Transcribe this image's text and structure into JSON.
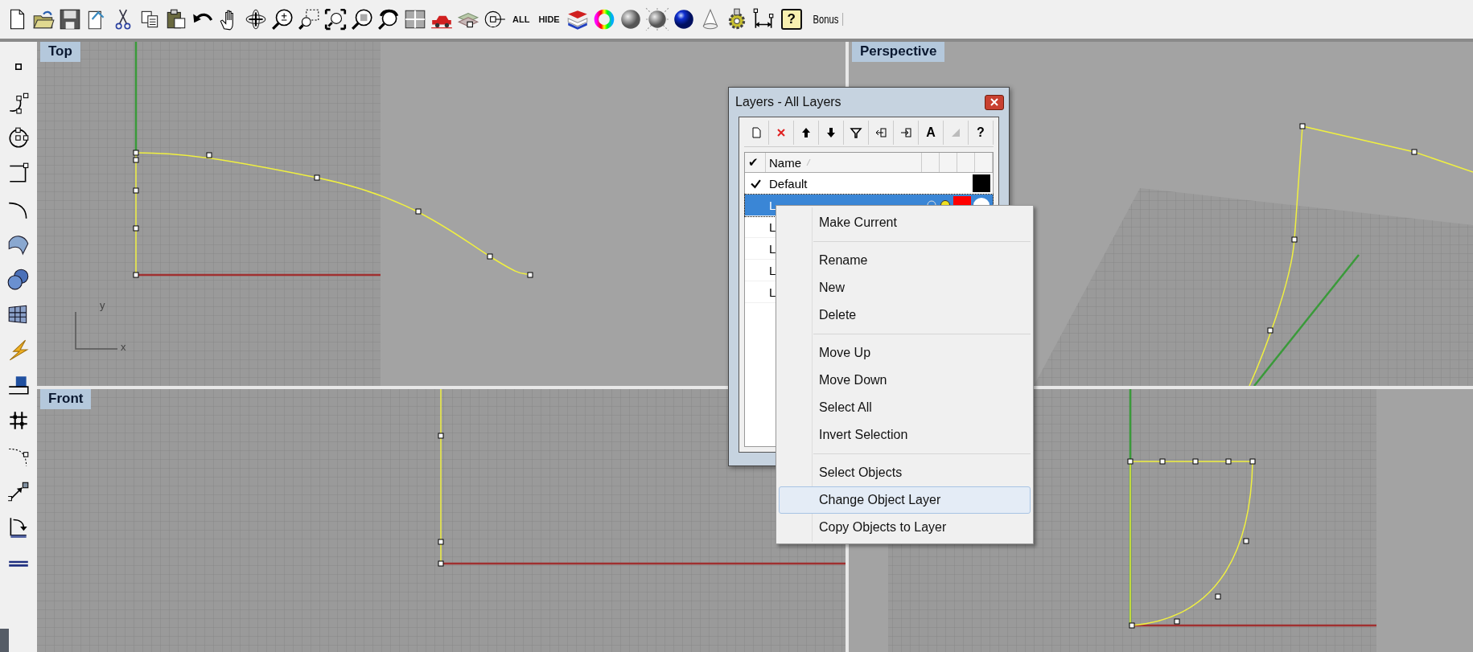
{
  "toolbar": {
    "items": [
      {
        "kind": "new"
      },
      {
        "kind": "open"
      },
      {
        "kind": "save"
      },
      {
        "kind": "props"
      },
      {
        "kind": "cut"
      },
      {
        "kind": "copy"
      },
      {
        "kind": "paste"
      },
      {
        "kind": "undo"
      },
      {
        "kind": "pan"
      },
      {
        "kind": "rotate"
      },
      {
        "kind": "zoom"
      },
      {
        "kind": "zoomwin"
      },
      {
        "kind": "zoomext"
      },
      {
        "kind": "zoomsel"
      },
      {
        "kind": "undoview"
      },
      {
        "kind": "fourview"
      },
      {
        "kind": "car"
      },
      {
        "kind": "gridlayers"
      },
      {
        "kind": "point"
      },
      {
        "kind": "text",
        "label": "ALL"
      },
      {
        "kind": "text",
        "label": "HIDE"
      },
      {
        "kind": "stack"
      },
      {
        "kind": "wheel"
      },
      {
        "kind": "sphere"
      },
      {
        "kind": "wiresphere"
      },
      {
        "kind": "bluesphere"
      },
      {
        "kind": "cone"
      },
      {
        "kind": "gear"
      },
      {
        "kind": "dim"
      },
      {
        "kind": "help",
        "label": "?"
      },
      {
        "kind": "bonus",
        "label": "Bonus"
      }
    ]
  },
  "side_toolbar": {
    "items": [
      {
        "kind": "point"
      },
      {
        "kind": "arc"
      },
      {
        "kind": "circle"
      },
      {
        "kind": "rect"
      },
      {
        "kind": "curve"
      },
      {
        "kind": "surface"
      },
      {
        "kind": "solids"
      },
      {
        "kind": "mesh"
      },
      {
        "kind": "bolt"
      },
      {
        "kind": "extrude"
      },
      {
        "kind": "gridpts"
      },
      {
        "kind": "curvepts"
      },
      {
        "kind": "scale"
      },
      {
        "kind": "bend"
      },
      {
        "kind": "bars"
      }
    ]
  },
  "viewports": [
    {
      "kind": "top",
      "label": "Top",
      "axis_labels": [
        "y",
        "x"
      ]
    },
    {
      "kind": "perspective",
      "label": "Perspective"
    },
    {
      "kind": "front",
      "label": "Front"
    },
    {
      "kind": "right"
    }
  ],
  "layers_dialog": {
    "title": "Layers - All Layers",
    "toolbar": [
      {
        "kind": "new"
      },
      {
        "kind": "delete"
      },
      {
        "kind": "up"
      },
      {
        "kind": "down"
      },
      {
        "kind": "filter"
      },
      {
        "kind": "import"
      },
      {
        "kind": "export"
      },
      {
        "kind": "text",
        "label": "A"
      },
      {
        "kind": "shade"
      },
      {
        "kind": "text",
        "label": "?"
      }
    ],
    "header": {
      "check": "✔",
      "name": "Name"
    },
    "rows": [
      {
        "name": "Default",
        "current": true,
        "selected": false,
        "color": "#000000"
      },
      {
        "name": "L",
        "current": false,
        "selected": true,
        "color": "#ff0000",
        "on": true
      },
      {
        "name": "L",
        "current": false,
        "selected": false
      },
      {
        "name": "L",
        "current": false,
        "selected": false
      },
      {
        "name": "L",
        "current": false,
        "selected": false
      },
      {
        "name": "L",
        "current": false,
        "selected": false
      }
    ]
  },
  "context_menu": {
    "groups": [
      {
        "items": [
          {
            "label": "Make Current",
            "selected": false
          }
        ]
      },
      {
        "items": [
          {
            "label": "Rename",
            "selected": false
          },
          {
            "label": "New",
            "selected": false
          },
          {
            "label": "Delete",
            "selected": false
          }
        ]
      },
      {
        "items": [
          {
            "label": "Move Up",
            "selected": false
          },
          {
            "label": "Move Down",
            "selected": false
          },
          {
            "label": "Select All",
            "selected": false
          },
          {
            "label": "Invert Selection",
            "selected": false
          }
        ]
      },
      {
        "items": [
          {
            "label": "Select Objects",
            "selected": false
          },
          {
            "label": "Change Object Layer",
            "selected": true
          },
          {
            "label": "Copy Objects to Layer",
            "selected": false
          }
        ]
      }
    ]
  }
}
